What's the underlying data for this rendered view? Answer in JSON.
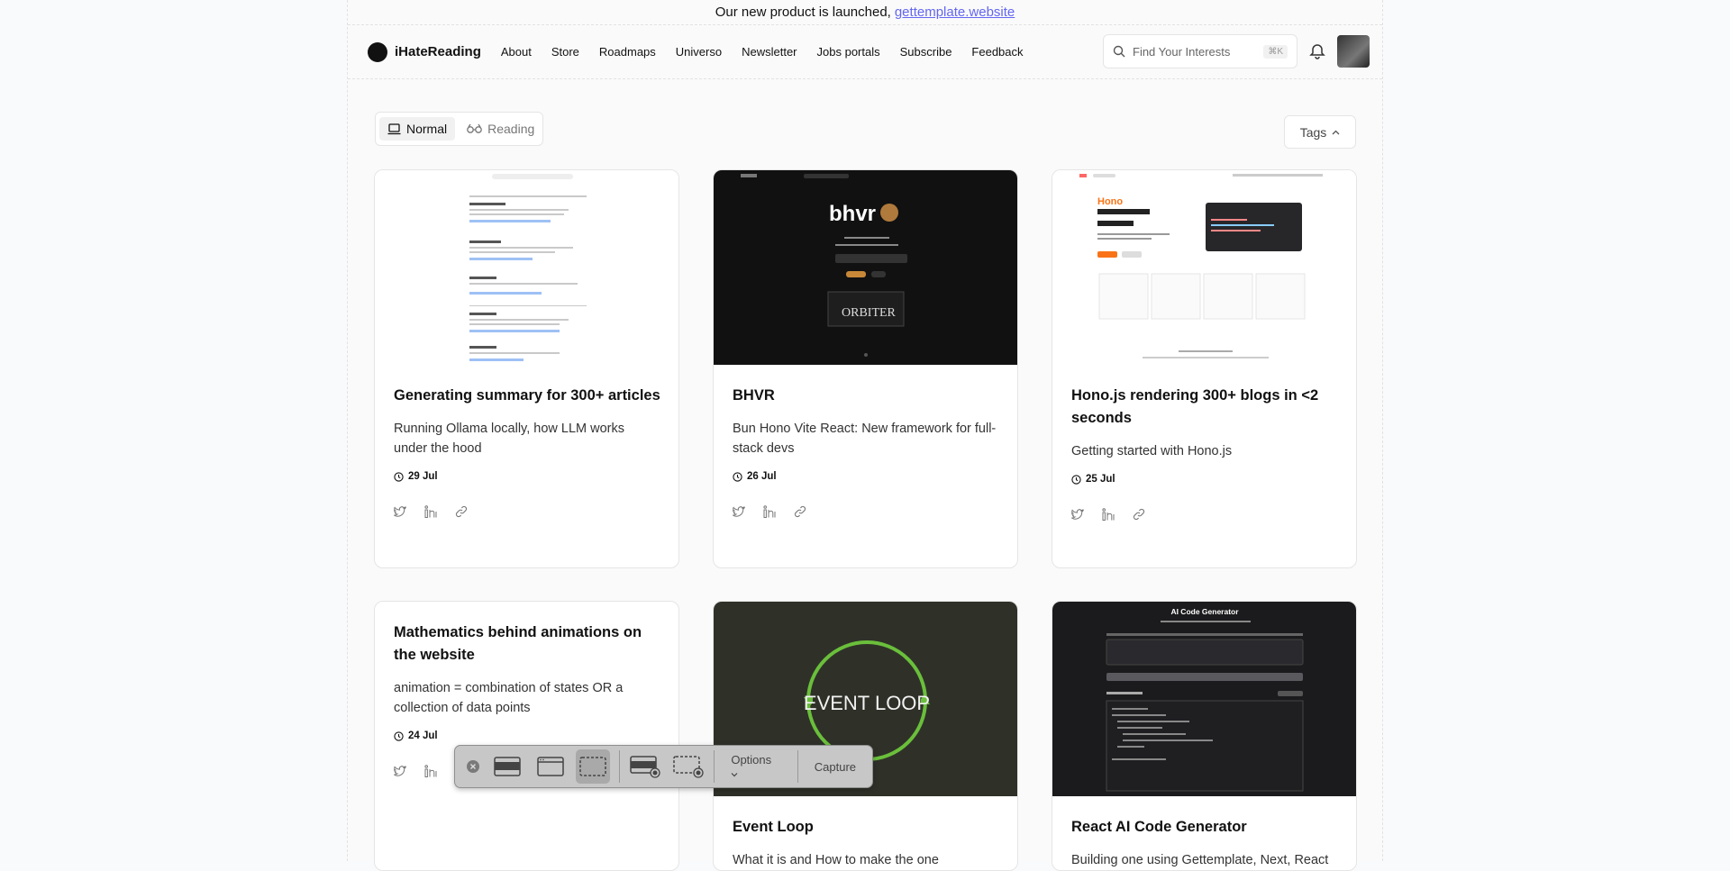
{
  "announcement": {
    "text": "Our new product is launched,",
    "link": "gettemplate.website"
  },
  "nav": {
    "brand": "iHateReading",
    "links": [
      "About",
      "Store",
      "Roadmaps",
      "Universo",
      "Newsletter",
      "Jobs portals",
      "Subscribe",
      "Feedback"
    ],
    "search_placeholder": "Find Your Interests",
    "search_shortcut": "⌘K"
  },
  "view_toggle": {
    "normal": "Normal",
    "reading": "Reading"
  },
  "tags_label": "Tags",
  "cards": [
    {
      "title": "Generating summary for 300+ articles",
      "desc": "Running Ollama locally, how LLM works under the hood",
      "date": "29 Jul"
    },
    {
      "title": "BHVR",
      "desc": "Bun Hono Vite React: New framework for full-stack devs",
      "date": "26 Jul",
      "thumb_text": "bhvr"
    },
    {
      "title": "Hono.js rendering 300+ blogs in <2 seconds",
      "desc": "Getting started with Hono.js",
      "date": "25 Jul",
      "thumb_text": "Hono"
    },
    {
      "title": "Mathematics behind animations on the website",
      "desc": "animation = combination of states OR a collection of data points",
      "date": "24 Jul"
    },
    {
      "title": "Event Loop",
      "desc": "What it is and How to make the one",
      "thumb_text": "EVENT LOOP"
    },
    {
      "title": "React AI Code Generator",
      "desc": "Building one using Gettemplate, Next, React",
      "thumb_text": "AI Code Generator"
    }
  ],
  "capture_toolbar": {
    "options": "Options",
    "capture": "Capture"
  }
}
